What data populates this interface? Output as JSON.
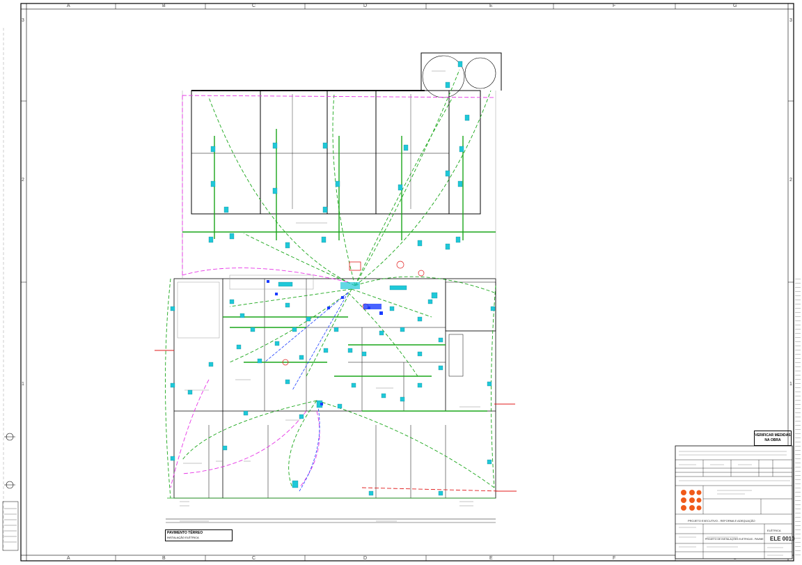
{
  "sheet": {
    "columns": [
      "A",
      "B",
      "C",
      "D",
      "E",
      "F",
      "G"
    ],
    "rows": [
      "3",
      "2",
      "1"
    ]
  },
  "drawing": {
    "floor_title": "PAVIMENTO TÉRREO",
    "floor_subtitle": "INSTALAÇÃO ELÉTRICA",
    "verify_note": "VERIFICAR MEDIDAS NA OBRA",
    "sheet_code": "ELE 0010",
    "room_labels": [
      "SALA DE REUNIÃO",
      "DEPÓSITO",
      "COZINHA",
      "SALA DE ESPERA",
      "COPA",
      "SALA DE TREINAMENTO"
    ],
    "colors": {
      "circuit_green": "#19a619",
      "circuit_magenta": "#e633e6",
      "device_cyan": "#1fc8d8",
      "device_blue": "#1a3cff",
      "alert_red": "#e01818",
      "wall_black": "#000000",
      "logo_orange": "#f05a1a"
    }
  },
  "title_block": {
    "project_line": "PROJETO EXECUTIVO - REFORMA E ADEQUAÇÃO",
    "drawing_line": "PROJETO DE INSTALAÇÕES ELÉTRICAS - PAVIMENTO TÉRREO",
    "discipline": "ELÉTRICA"
  }
}
